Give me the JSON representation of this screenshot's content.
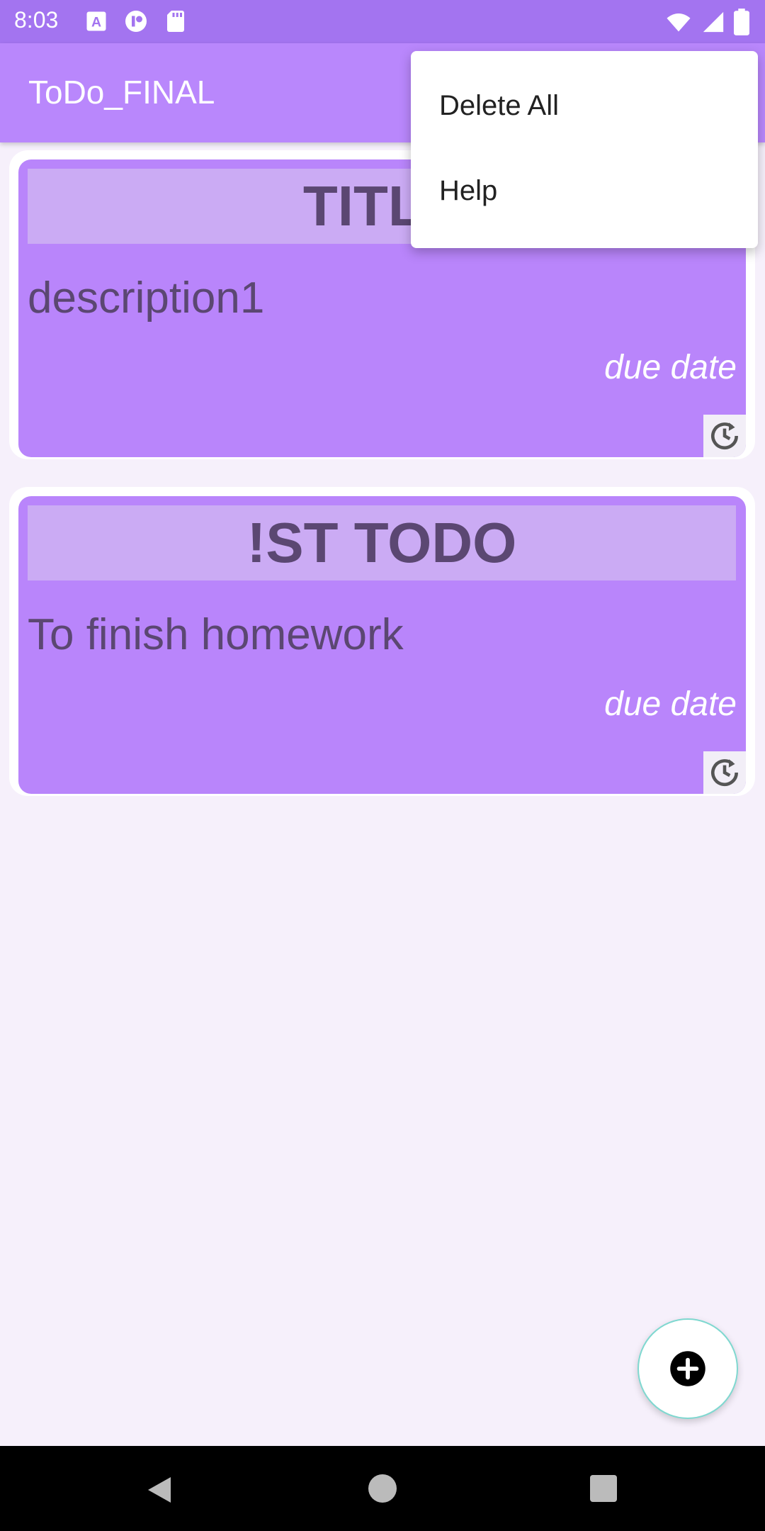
{
  "status_bar": {
    "time": "8:03",
    "icons_left": [
      "a-letter-icon",
      "app-logo-icon",
      "sd-card-icon"
    ],
    "icons_right": [
      "wifi-icon",
      "signal-icon",
      "battery-icon"
    ]
  },
  "app_bar": {
    "title": "ToDo_FINAL"
  },
  "overflow_menu": {
    "items": [
      {
        "label": "Delete All"
      },
      {
        "label": "Help"
      }
    ]
  },
  "todos": [
    {
      "title": "TITLE",
      "description": "description1",
      "due": "due date"
    },
    {
      "title": "!ST TODO",
      "description": "To finish homework",
      "due": "due date"
    }
  ],
  "fab": {
    "icon": "plus-icon"
  },
  "nav_bar": {
    "icons": [
      "back-icon",
      "home-icon",
      "recents-icon"
    ]
  },
  "colors": {
    "status_bar": "#a374f0",
    "app_bar": "#b987fc",
    "card": "#b985fb",
    "title_box": "#cbabf4",
    "text_dark": "#5b4772",
    "background": "#f6f0fb"
  }
}
